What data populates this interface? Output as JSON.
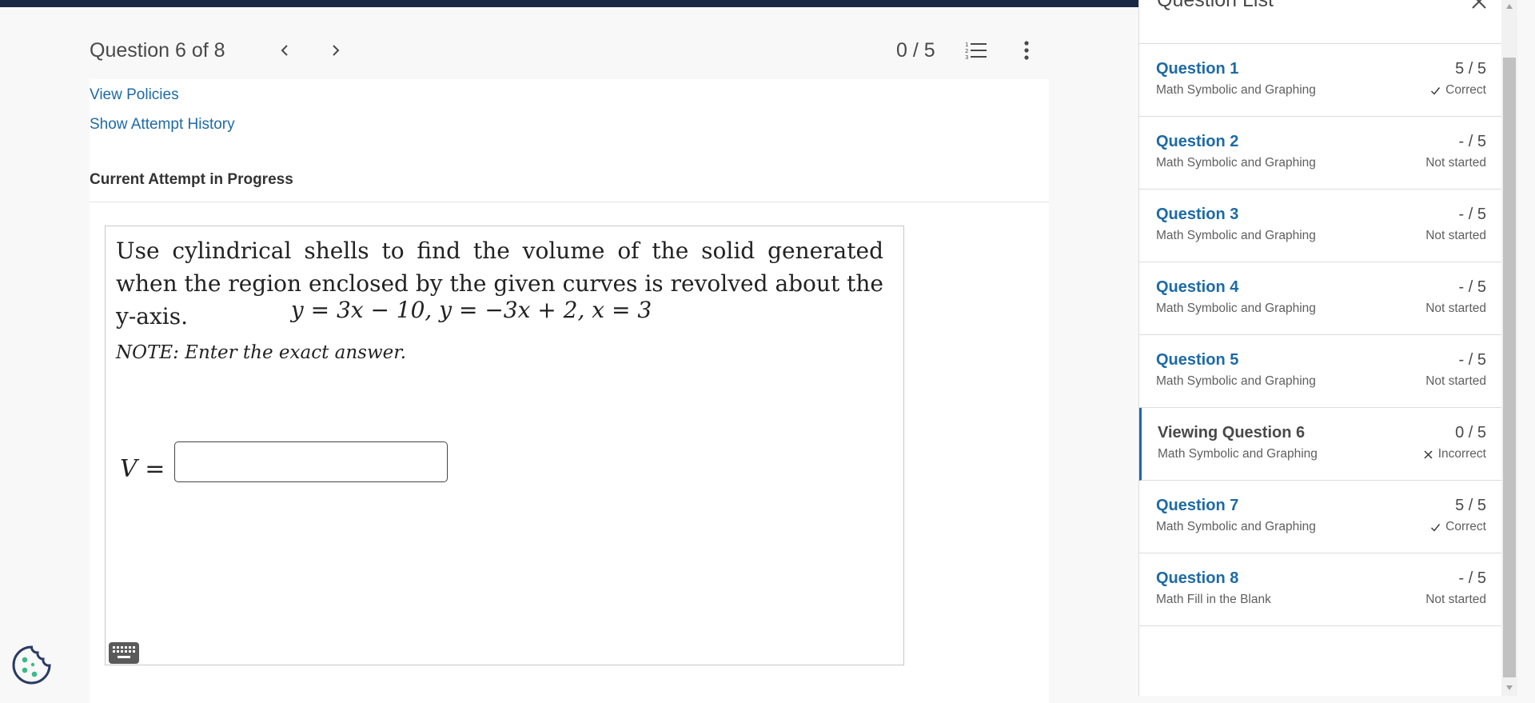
{
  "header": {
    "question_counter": "Question 6 of 8",
    "score": "0 / 5"
  },
  "links": {
    "view_policies": "View Policies",
    "attempt_history": "Show Attempt History"
  },
  "attempt_label": "Current Attempt in Progress",
  "question": {
    "text": "Use cylindrical shells to find the volume of the solid generated when the region enclosed by the given curves is revolved about the y-axis.",
    "equations": "y = 3x − 10,   y = −3x + 2,   x = 3",
    "note": "NOTE: Enter the exact answer.",
    "answer_label": "V =",
    "answer_value": ""
  },
  "panel": {
    "title": "Question List",
    "items": [
      {
        "name": "Question 1",
        "type": "Math Symbolic and Graphing",
        "score": "5 / 5",
        "status": "Correct",
        "status_icon": "check-icon"
      },
      {
        "name": "Question 2",
        "type": "Math Symbolic and Graphing",
        "score": "- / 5",
        "status": "Not started",
        "status_icon": ""
      },
      {
        "name": "Question 3",
        "type": "Math Symbolic and Graphing",
        "score": "- / 5",
        "status": "Not started",
        "status_icon": ""
      },
      {
        "name": "Question 4",
        "type": "Math Symbolic and Graphing",
        "score": "- / 5",
        "status": "Not started",
        "status_icon": ""
      },
      {
        "name": "Question 5",
        "type": "Math Symbolic and Graphing",
        "score": "- / 5",
        "status": "Not started",
        "status_icon": ""
      },
      {
        "name": "Viewing Question 6",
        "type": "Math Symbolic and Graphing",
        "score": "0 / 5",
        "status": "Incorrect",
        "status_icon": "x-icon"
      },
      {
        "name": "Question 7",
        "type": "Math Symbolic and Graphing",
        "score": "5 / 5",
        "status": "Correct",
        "status_icon": "check-icon"
      },
      {
        "name": "Question 8",
        "type": "Math Fill in the Blank",
        "score": "- / 5",
        "status": "Not started",
        "status_icon": ""
      }
    ]
  },
  "colors": {
    "link": "#1d6aa6",
    "topbar": "#1a2744",
    "cookie": "#2b3a67",
    "cookie_dots": "#3cb98a"
  }
}
